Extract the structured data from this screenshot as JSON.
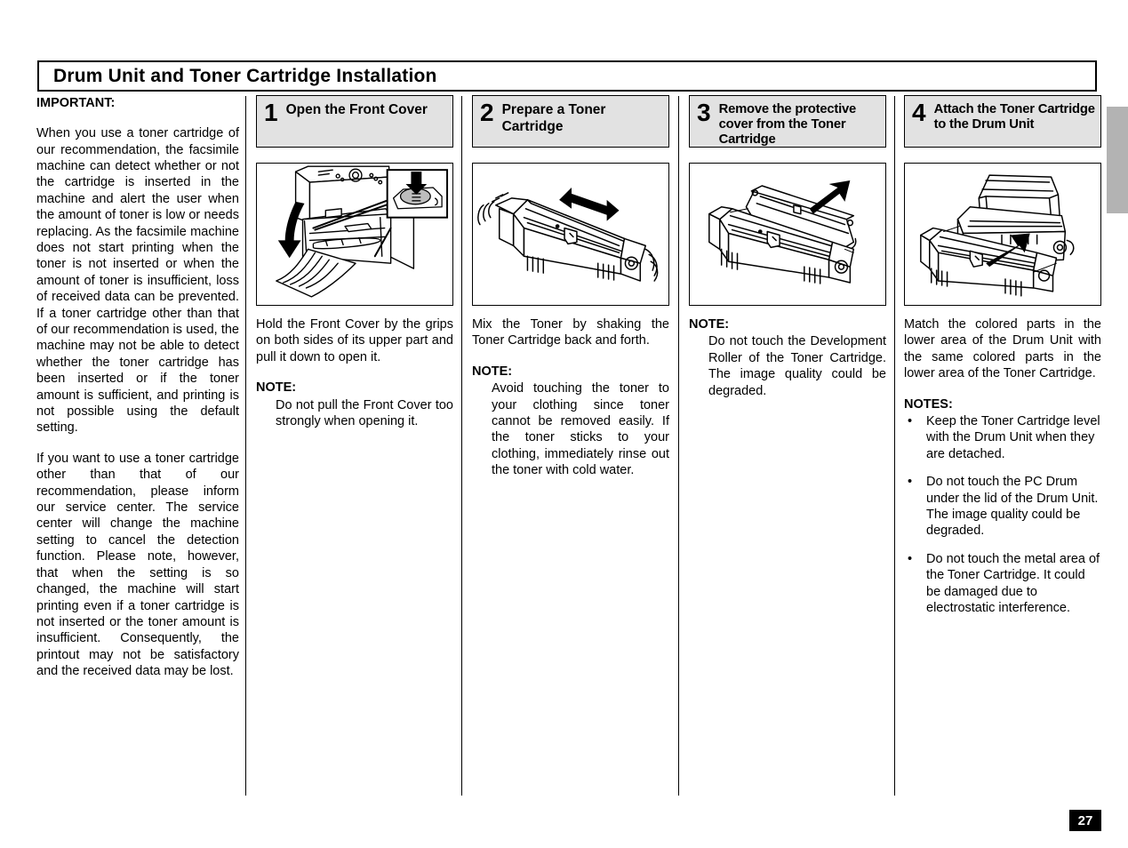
{
  "document": {
    "title": "Drum Unit and Toner Cartridge Installation",
    "page_number": "27"
  },
  "important": {
    "heading": "IMPORTANT:",
    "paragraph_1": "When you use a toner cartridge of our recommendation, the facsimile machine can detect whether or not the cartridge is inserted in the machine and alert the  user when the amount of toner is low or needs replacing. As the facsimile machine does not start printing when the toner is not inserted or when the amount of toner is insufficient, loss of received data can be prevented. If a toner cartridge other than that of our recommendation is used, the machine may not be able to detect whether the toner cartridge has been inserted or if the toner amount is sufficient, and printing is not possible using the default  setting.",
    "paragraph_2": "If you want to use a toner cartridge other than that of our recommendation, please inform our service center. The service center will change the machine setting to cancel the detection function. Please note, however, that when the setting is so changed, the machine will start printing even if a toner cartridge is not inserted or the toner amount is insufficient. Consequently, the printout may not be satisfactory and the received data may be lost."
  },
  "steps": [
    {
      "number": "1",
      "title": "Open the Front Cover",
      "illustration_name": "front-cover-open-illustration",
      "body": "Hold the Front Cover by the grips on both sides of its upper part and pull it down to open it.",
      "note_label": "NOTE:",
      "note_body": "Do not pull the Front Cover too strongly when opening it."
    },
    {
      "number": "2",
      "title": "Prepare a Toner Cartridge",
      "illustration_name": "toner-cartridge-shake-illustration",
      "body": "Mix the Toner by shaking the Toner Cartridge back and forth.",
      "note_label": "NOTE:",
      "note_body": "Avoid touching the toner to your clothing since toner cannot be removed easily. If the toner sticks to your clothing, immediately rinse out the toner with cold water."
    },
    {
      "number": "3",
      "title": "Remove the protective cover from the Toner Cartridge",
      "illustration_name": "remove-protective-cover-illustration",
      "body": "",
      "note_label": "NOTE:",
      "note_body": "Do not touch the Development Roller of the Toner Cartridge. The image quality could be degraded."
    },
    {
      "number": "4",
      "title": "Attach the Toner Cartridge to the Drum Unit",
      "illustration_name": "attach-toner-to-drum-illustration",
      "body": "Match the colored parts in the lower area of the Drum Unit with the same colored parts in the lower area of the Toner Cartridge.",
      "notes_label": "NOTES:",
      "bullet_marker": "•",
      "notes": [
        "Keep the Toner Cartridge level with the Drum Unit when they are detached.",
        "Do not touch the PC Drum under the lid of the Drum Unit. The image quality could be degraded.",
        "Do not touch the metal area of the Toner Cartridge. It could be damaged due to electrostatic  interference."
      ]
    }
  ],
  "colors": {
    "header_fill": "#e2e2e2",
    "edge_tab": "#b3b3b3",
    "page_number_bg": "#000000",
    "text": "#000000"
  }
}
